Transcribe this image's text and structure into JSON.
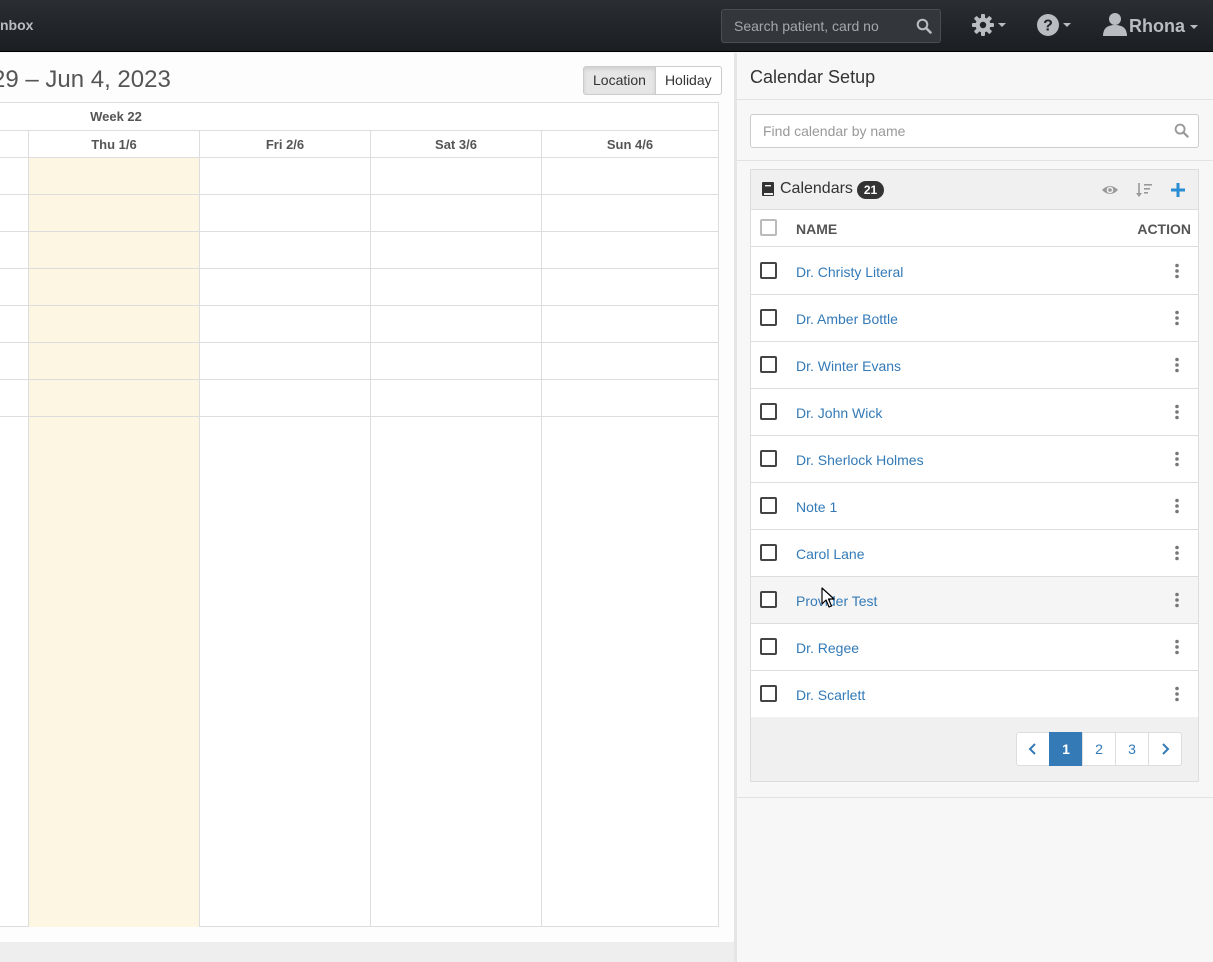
{
  "navbar": {
    "inbox_label": "nbox",
    "search_placeholder": "Search patient, card no",
    "user_name": "Rhona",
    "icons": [
      "search-icon",
      "gear-icon",
      "question-icon",
      "user-icon"
    ]
  },
  "calendar": {
    "date_range": "29 – Jun 4, 2023",
    "view_buttons": {
      "location": "Location",
      "holiday": "Holiday"
    },
    "week_label": "Week 22",
    "days": [
      "Thu 1/6",
      "Fri 2/6",
      "Sat 3/6",
      "Sun 4/6"
    ]
  },
  "setup": {
    "title": "Calendar Setup",
    "find_placeholder": "Find calendar by name",
    "panel_title": "Calendars",
    "count": "21",
    "col_name": "NAME",
    "col_action": "ACTION",
    "rows": [
      "Dr. Christy Literal",
      "Dr. Amber Bottle",
      "Dr. Winter Evans",
      "Dr. John Wick",
      "Dr. Sherlock Holmes",
      "Note 1",
      "Carol Lane",
      "Provider Test",
      "Dr. Regee",
      "Dr. Scarlett"
    ],
    "pages": [
      "1",
      "2",
      "3"
    ],
    "current_page": "1"
  },
  "colors": {
    "navbar": "#1f2226",
    "link": "#337ab7",
    "today": "#fdf6e2",
    "add": "#2a8dd4"
  }
}
